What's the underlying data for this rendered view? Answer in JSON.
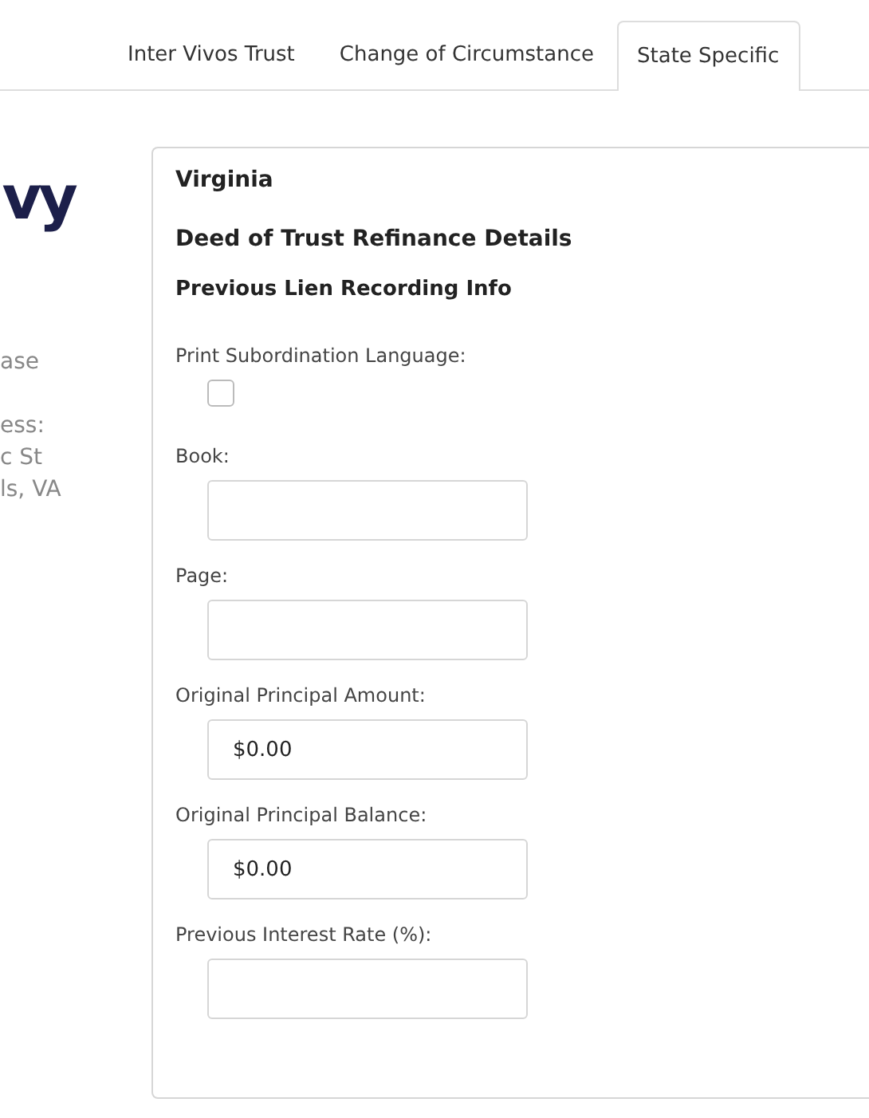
{
  "tabs": [
    {
      "label": "Inter Vivos Trust",
      "selected": false
    },
    {
      "label": "Change of Circumstance",
      "selected": false
    },
    {
      "label": "State Specific",
      "selected": true
    }
  ],
  "sidebar": {
    "logo": "vy",
    "lines": [
      "ase",
      "ess:",
      "c St",
      "ls, VA"
    ]
  },
  "panel": {
    "state": "Virginia",
    "title": "Deed of Trust Refinance Details",
    "subtitle": "Previous Lien Recording Info",
    "fields": [
      {
        "kind": "checkbox",
        "label": "Print Subordination Language:",
        "checked": false
      },
      {
        "kind": "text",
        "label": "Book:"
      },
      {
        "kind": "text",
        "label": "Page:"
      },
      {
        "kind": "text",
        "label": "Original Principal Amount:",
        "value": "$0.00"
      },
      {
        "kind": "text",
        "label": "Original Principal Balance:",
        "value": "$0.00"
      },
      {
        "kind": "text",
        "label": "Previous Interest Rate (%):"
      }
    ]
  }
}
